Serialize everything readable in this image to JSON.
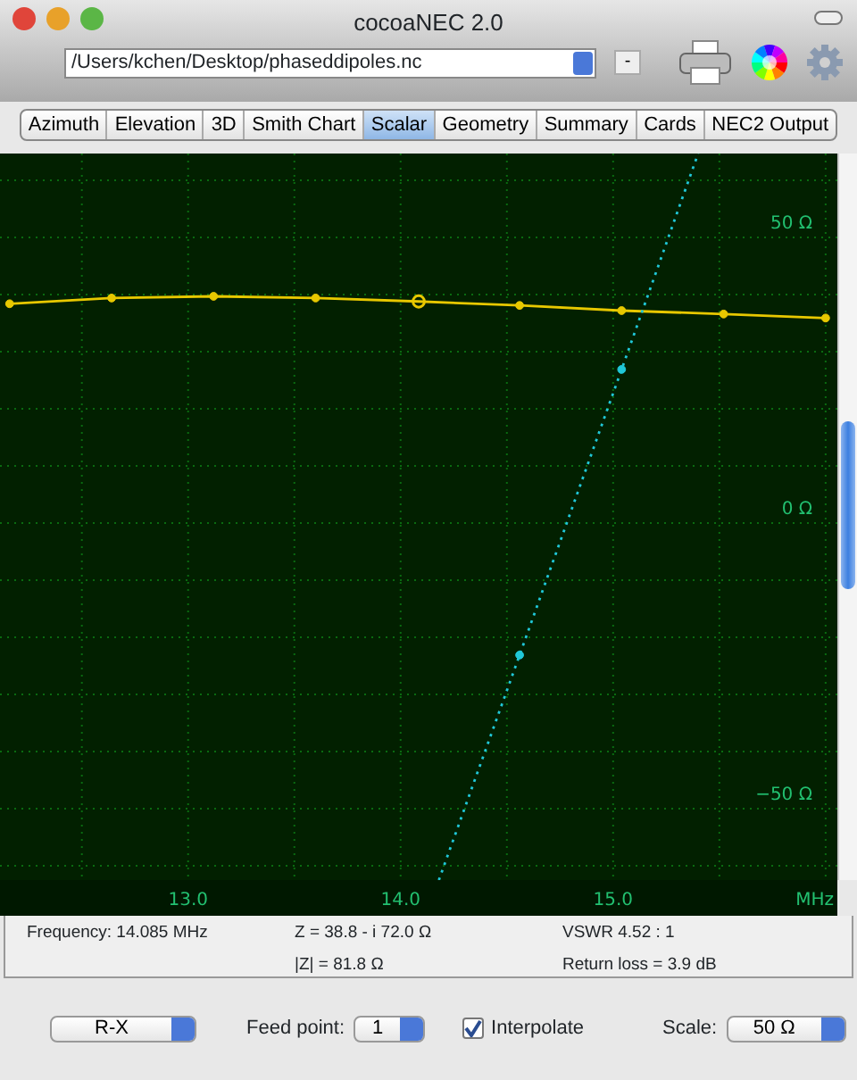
{
  "window": {
    "title": "cocoaNEC 2.0"
  },
  "toolbar": {
    "file_path": "/Users/kchen/Desktop/phaseddipoles.nc",
    "minus_button": "-"
  },
  "tabs": [
    {
      "label": "Azimuth",
      "selected": false
    },
    {
      "label": "Elevation",
      "selected": false
    },
    {
      "label": "3D",
      "selected": false
    },
    {
      "label": "Smith Chart",
      "selected": false
    },
    {
      "label": "Scalar",
      "selected": true
    },
    {
      "label": "Geometry",
      "selected": false
    },
    {
      "label": "Summary",
      "selected": false
    },
    {
      "label": "Cards",
      "selected": false
    },
    {
      "label": "NEC2 Output",
      "selected": false
    }
  ],
  "plot": {
    "points": [
      {
        "selected": false
      },
      {
        "selected": false
      },
      {
        "selected": false
      },
      {
        "selected": false
      },
      {
        "selected": true
      },
      {
        "selected": false
      },
      {
        "selected": false
      },
      {
        "selected": false
      },
      {
        "selected": false
      }
    ],
    "chart_data": {
      "type": "line",
      "grid": true,
      "xlabel": "MHz",
      "xlim": [
        12.14,
        16.03
      ],
      "ylim": [
        -62.5,
        64.7
      ],
      "xticks": [
        {
          "value": 13,
          "label": "13.0"
        },
        {
          "value": 14,
          "label": "14.0"
        },
        {
          "value": 15,
          "label": "15.0"
        }
      ],
      "yticks": [
        {
          "value": 50,
          "label": "50 Ω"
        },
        {
          "value": 0,
          "label": "0 Ω"
        },
        {
          "value": -50,
          "label": "−50 Ω"
        }
      ],
      "x": [
        12.16,
        12.64,
        13.12,
        13.6,
        14.085,
        14.18,
        14.56,
        15.04,
        15.4,
        15.52,
        16.0
      ],
      "series": [
        {
          "color": "#e8c800",
          "marker": "circle",
          "line_style": "solid",
          "values": [
            38.4,
            39.4,
            39.7,
            39.4,
            38.8,
            null,
            38.1,
            37.2,
            null,
            36.6,
            35.9
          ]
        },
        {
          "color": "#20c8d8",
          "marker": "circle",
          "line_style": "dotted",
          "values": [
            null,
            null,
            null,
            null,
            null,
            -62.5,
            -23.1,
            26.9,
            64.7,
            null,
            null
          ]
        }
      ]
    }
  },
  "info": {
    "frequency": "Frequency: 14.085 MHz",
    "impedance": "Z = 38.8 - i 72.0 Ω",
    "magnitude": "|Z| = 81.8 Ω",
    "vswr": "VSWR 4.52 : 1",
    "return_loss": "Return loss = 3.9 dB"
  },
  "controls": {
    "mode": "R-X",
    "feed_label": "Feed point:",
    "feed_point": "1",
    "interpolate": {
      "label": "Interpolate",
      "checked": true
    },
    "scale_label": "Scale:",
    "scale": "50 Ω"
  }
}
